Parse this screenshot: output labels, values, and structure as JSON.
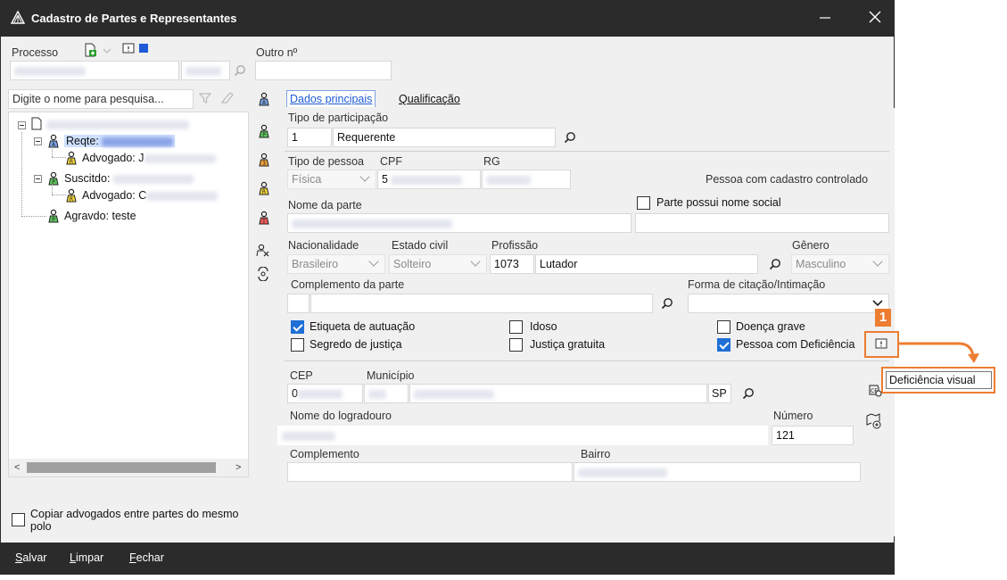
{
  "window": {
    "title": "Cadastro de Partes e Representantes"
  },
  "header": {
    "processo_label": "Processo",
    "outro_label": "Outro nº",
    "outro_value": ""
  },
  "search": {
    "placeholder": "Digite o nome para pesquisa..."
  },
  "tree": {
    "root": "",
    "items": [
      {
        "label": "Reqte: "
      },
      {
        "label": "Advogado: J"
      },
      {
        "label": "Suscitdo: "
      },
      {
        "label": "Advogado: C"
      },
      {
        "label": "Agravdo: teste"
      }
    ]
  },
  "copy_lawyers": {
    "label": "Copiar advogados entre partes do mesmo polo"
  },
  "tabs": [
    {
      "label": "Dados principais"
    },
    {
      "label": "Qualificação"
    }
  ],
  "form": {
    "tipo_participacao_label": "Tipo de participação",
    "tipo_participacao_code": "1",
    "tipo_participacao_value": "Requerente",
    "tipo_pessoa_label": "Tipo de pessoa",
    "tipo_pessoa_value": "Física",
    "cpf_label": "CPF",
    "cpf_value": "5",
    "rg_label": "RG",
    "cadastro_controlado": "Pessoa com cadastro controlado",
    "nome_parte_label": "Nome da parte",
    "nome_social_label": "Parte possui nome social",
    "nacionalidade_label": "Nacionalidade",
    "nacionalidade_value": "Brasileiro",
    "estado_civil_label": "Estado civil",
    "estado_civil_value": "Solteiro",
    "profissao_label": "Profissão",
    "profissao_code": "1073",
    "profissao_value": "Lutador",
    "genero_label": "Gênero",
    "genero_value": "Masculino",
    "complemento_parte_label": "Complemento da parte",
    "forma_citacao_label": "Forma de citação/Intimação",
    "checkboxes": [
      {
        "label": "Etiqueta de autuação",
        "checked": true
      },
      {
        "label": "Idoso",
        "checked": false
      },
      {
        "label": "Doença grave",
        "checked": false
      },
      {
        "label": "Segredo de justiça",
        "checked": false
      },
      {
        "label": "Justiça gratuita",
        "checked": false
      },
      {
        "label": "Pessoa com Deficiência",
        "checked": true
      }
    ],
    "cep_label": "CEP",
    "cep_value": "0",
    "municipio_label": "Município",
    "uf_value": "SP",
    "logradouro_label": "Nome do logradouro",
    "numero_label": "Número",
    "numero_value": "121",
    "complemento_label": "Complemento",
    "bairro_label": "Bairro"
  },
  "annotation": {
    "step": "1",
    "tooltip": "Deficiência visual",
    "color": "#ed7d31"
  },
  "footer": {
    "salvar_first": "S",
    "salvar_rest": "alvar",
    "limpar_first": "L",
    "limpar_rest": "impar",
    "fechar_first": "F",
    "fechar_rest": "echar"
  },
  "colors": {
    "titlebar": "#2b2b2b",
    "accent": "#1f6fd6",
    "selection": "#cfe0ff"
  }
}
